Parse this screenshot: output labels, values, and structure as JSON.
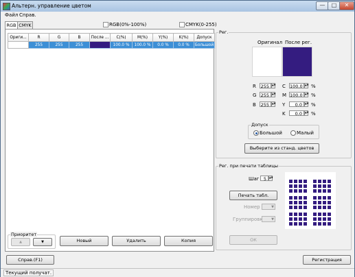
{
  "window": {
    "title": "Альтерн. управление цветом",
    "buttons": [
      "—",
      "□",
      "✕"
    ]
  },
  "menu": [
    "Файл",
    "Справ."
  ],
  "tabs": [
    "RGB",
    "CMYK"
  ],
  "options": {
    "rgb_percent": "RGB(0%-100%)",
    "cmyk_range": "CMYK(0-255)"
  },
  "table": {
    "headers": [
      "Ориги...",
      "R",
      "G",
      "B",
      "После ...",
      "C(%)",
      "M(%)",
      "Y(%)",
      "K(%)",
      "Допуск"
    ],
    "row": {
      "r": "255",
      "g": "255",
      "b": "255",
      "c": "100.0 %",
      "m": "100.0 %",
      "y": "0.0 %",
      "k": "0.0 %",
      "tolerance": "Большой"
    }
  },
  "colors": {
    "original": "#ffffff",
    "after": "#341c80",
    "selected": "#3d8fd6"
  },
  "reg": {
    "title": "Рег.",
    "original_label": "Оригинал",
    "after_label": "После рег.",
    "r_label": "R",
    "g_label": "G",
    "b_label": "B",
    "r": "255",
    "g": "255",
    "b": "255",
    "c_label": "C",
    "m_label": "M",
    "y_label": "Y",
    "k_label": "K",
    "c": "100.0",
    "m": "100.0",
    "y": "0.0",
    "k": "0.0",
    "percent": "%",
    "tolerance_title": "Допуск",
    "tolerance_large": "Большой",
    "tolerance_small": "Малый",
    "select_button": "Выберите из станд. цветов"
  },
  "print_table": {
    "title": "Рег. при печати таблицы",
    "step_label": "Шаг",
    "step": "5",
    "print_button": "Печать табл.",
    "number_label": "Номер",
    "grouping_label": "Группировка",
    "ok_button": "ОК"
  },
  "priority": {
    "title": "Приоритет",
    "up": "▲",
    "down": "▼"
  },
  "actions": {
    "new": "Новый",
    "delete": "Удалить",
    "copy": "Копия"
  },
  "help_button": "Справ.(F1)",
  "register_button": "Регистрация",
  "status": "Текущий получат."
}
